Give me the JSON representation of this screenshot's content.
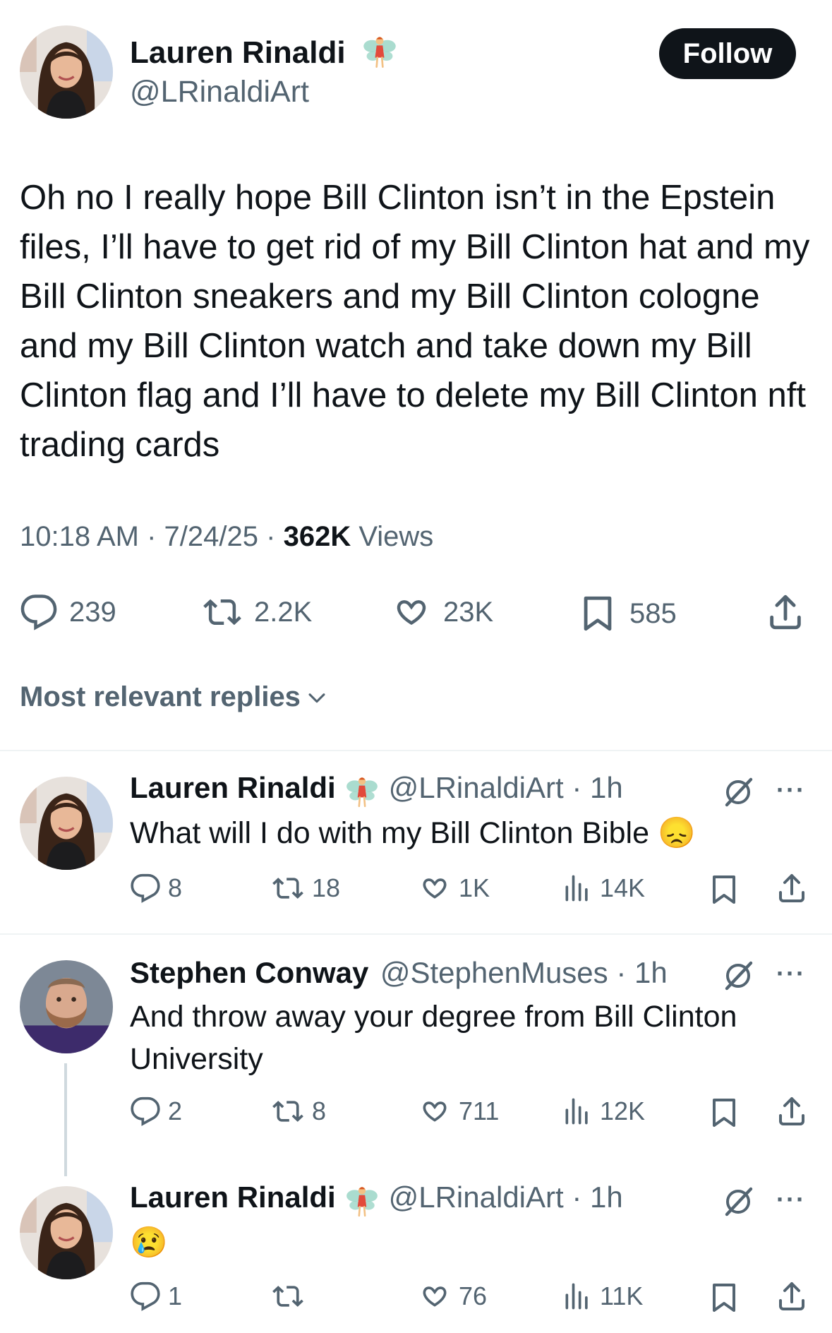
{
  "main_tweet": {
    "name": "Lauren Rinaldi",
    "handle": "@LRinaldiArt",
    "follow_label": "Follow",
    "text": "Oh no I really hope Bill Clinton isn’t in the Epstein files, I’ll have to get rid of my Bill Clinton hat and my Bill Clinton sneakers and my Bill Clinton cologne and my Bill Clinton watch and take down my Bill Clinton flag and I’ll have to delete my Bill Clinton nft trading cards",
    "time": "10:18 AM · 7/24/25 ·",
    "views_count": "362K",
    "views_label": "Views",
    "stats": {
      "replies": "239",
      "reposts": "2.2K",
      "likes": "23K",
      "bookmarks": "585"
    }
  },
  "sort_label": "Most relevant replies",
  "replies": [
    {
      "name": "Lauren Rinaldi",
      "handle": "@LRinaldiArt · 1h",
      "text": "What will I do with my Bill Clinton Bible 😞",
      "replies": "8",
      "reposts": "18",
      "likes": "1K",
      "views": "14K"
    },
    {
      "name": "Stephen Conway",
      "handle": "@StephenMuses · 1h",
      "text": "And throw away your degree from Bill Clinton University",
      "replies": "2",
      "reposts": "8",
      "likes": "711",
      "views": "12K"
    },
    {
      "name": "Lauren Rinaldi",
      "handle": "@LRinaldiArt · 1h",
      "text": "😢",
      "replies": "1",
      "reposts": "",
      "likes": "76",
      "views": "11K"
    }
  ],
  "colors": {
    "text_primary": "#0f1419",
    "text_secondary": "#536471",
    "divider": "#eff3f4",
    "button_bg": "#0f1419"
  },
  "icons": [
    "fairy-emoji",
    "reply-icon",
    "repost-icon",
    "like-icon",
    "bookmark-icon",
    "share-icon",
    "views-icon",
    "grok-icon",
    "more-icon",
    "chevron-down-icon"
  ]
}
